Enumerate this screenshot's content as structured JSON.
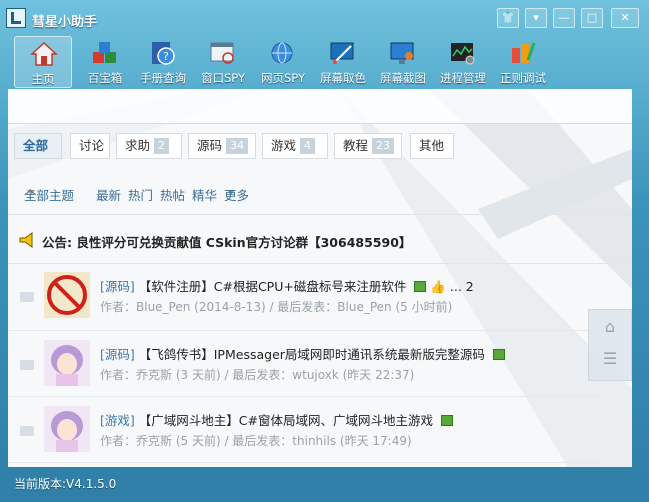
{
  "window": {
    "title": "彗星小助手",
    "buttons": [
      {
        "name": "skin-button",
        "glyph": "👕"
      },
      {
        "name": "menu-button",
        "glyph": "▾"
      },
      {
        "name": "minimize-button",
        "glyph": "—"
      },
      {
        "name": "maximize-button",
        "glyph": "□"
      },
      {
        "name": "close-button",
        "glyph": "✕"
      }
    ]
  },
  "toolbar": {
    "items": [
      {
        "label": "主页",
        "icon": "home-icon",
        "active": true
      },
      {
        "label": "百宝箱",
        "icon": "toolbox-icon"
      },
      {
        "label": "手册查询",
        "icon": "help-book-icon"
      },
      {
        "label": "窗口SPY",
        "icon": "window-spy-icon"
      },
      {
        "label": "网页SPY",
        "icon": "web-spy-icon"
      },
      {
        "label": "屏幕取色",
        "icon": "color-picker-icon"
      },
      {
        "label": "屏幕截图",
        "icon": "screenshot-icon"
      },
      {
        "label": "进程管理",
        "icon": "process-manager-icon"
      },
      {
        "label": "正则调试",
        "icon": "regex-debug-icon"
      }
    ]
  },
  "tabs": [
    {
      "label": "全部",
      "count": "",
      "active": true
    },
    {
      "label": "讨论",
      "count": ""
    },
    {
      "label": "求助",
      "count": "2"
    },
    {
      "label": "源码",
      "count": "34"
    },
    {
      "label": "游戏",
      "count": "4"
    },
    {
      "label": "教程",
      "count": "23"
    },
    {
      "label": "其他",
      "count": ""
    }
  ],
  "filters": {
    "all_topics": "全部主题",
    "latest": "最新",
    "hot": "热门",
    "hot_posts": "热帖",
    "essence": "精华",
    "more": "更多"
  },
  "notice": "公告: 良性评分可兑换贡献值 CSkin官方讨论群【306485590】",
  "threads": [
    {
      "forum": "[源码]",
      "title": "【软件注册】C#根据CPU+磁盘标号来注册软件",
      "pages": "... 2",
      "meta": "作者：Blue_Pen (2014-8-13) / 最后发表：Blue_Pen (5 小时前)",
      "avatar": "no-ad-icon"
    },
    {
      "forum": "[源码]",
      "title": "【飞鸽传书】IPMessager局域网即时通讯系统最新版完整源码",
      "pages": "",
      "meta": "作者：乔克斯 (3 天前) / 最后发表：wtujoxk (昨天 22:37)",
      "avatar": "anime-avatar-icon"
    },
    {
      "forum": "[游戏]",
      "title": "【广域网斗地主】C#窗体局域网、广域网斗地主游戏",
      "pages": "",
      "meta": "作者：乔克斯 (5 天前) / 最后发表：thinhils (昨天 17:49)",
      "avatar": "anime-avatar-icon"
    }
  ],
  "side": {
    "top": "⌂",
    "list": "☰"
  },
  "status": "当前版本:V4.1.5.0"
}
